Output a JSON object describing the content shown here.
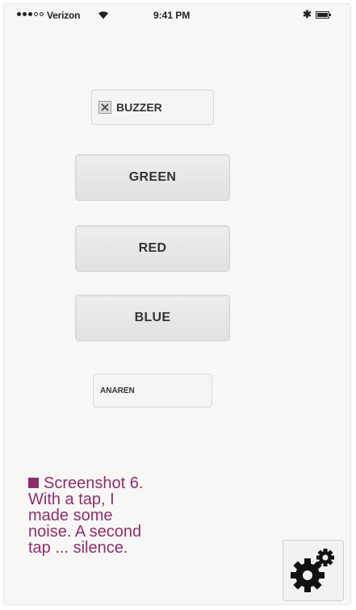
{
  "status_bar": {
    "carrier": "Verizon",
    "time": "9:41 PM",
    "signal_bars_filled": 3,
    "signal_bars_total": 5,
    "icons": [
      "wifi-icon",
      "bluetooth-icon",
      "battery-icon"
    ]
  },
  "controls": {
    "buzzer": {
      "label": "BUZZER",
      "checked": true
    },
    "green_label": "GREEN",
    "red_label": "RED",
    "blue_label": "BLUE",
    "anaren_label": "ANAREN"
  },
  "caption": {
    "lines": [
      "Screenshot 6.",
      "With a tap, I",
      "made some",
      "noise. A second",
      "tap ... silence."
    ]
  },
  "settings": {
    "icon": "gear-icon"
  },
  "colors": {
    "caption": "#8d2e6b",
    "background": "#f7f7f5",
    "button": "#e9e8e6"
  }
}
